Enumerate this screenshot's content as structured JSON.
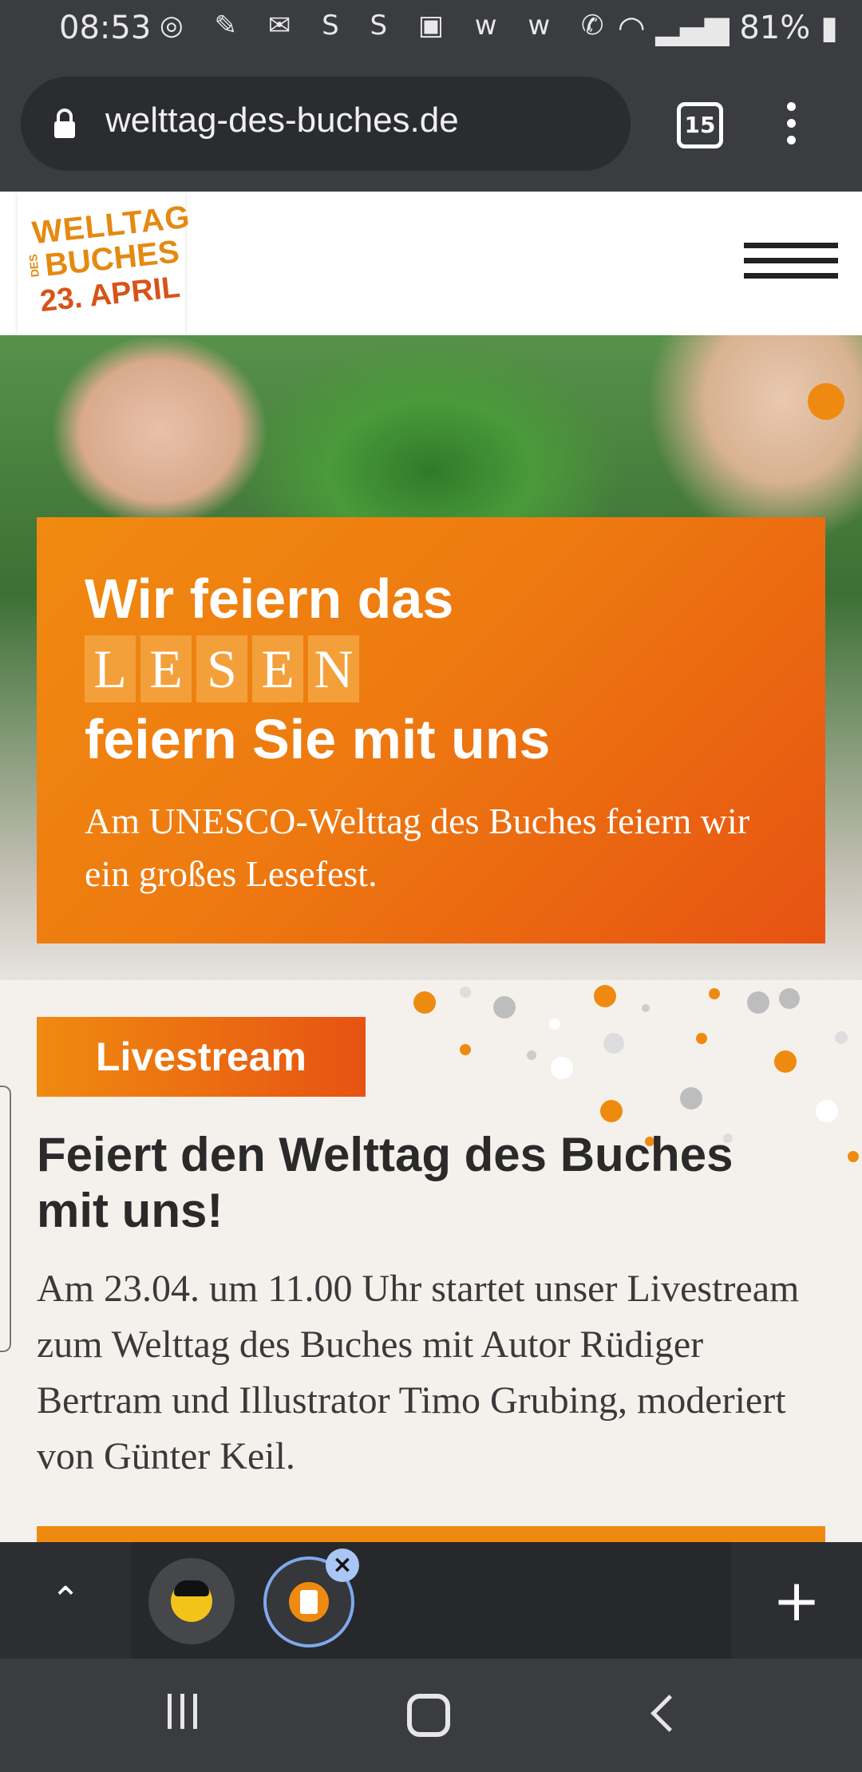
{
  "status": {
    "time": "08:53",
    "icons": "◎ ✎ ✉ S S ▣ w w ✆",
    "battery": "81%"
  },
  "browser": {
    "url": "welttag-des-buches.de",
    "tab_count": "15"
  },
  "site": {
    "logo": {
      "line1": "WELLTAG",
      "line2": "DES",
      "line3": "BUCHES",
      "line4": "23. APRIL"
    }
  },
  "hero": {
    "title_line1": "Wir feiern das",
    "highlight_letters": [
      "L",
      "E",
      "S",
      "E",
      "N"
    ],
    "title_line3": "feiern Sie mit uns",
    "subtitle": "Am UNESCO-Welttag des Buches feiern wir ein großes Lesefest."
  },
  "section": {
    "button": "Livestream",
    "title": "Feiert den Welttag des Buches mit uns!",
    "body": "Am 23.04. um 11.00 Uhr startet unser Livestream zum Welttag des Buches mit Autor Rüdiger Bertram und Illustrator Timo Grubing, moderiert von Günter Keil."
  },
  "tabbar": {
    "up": "⌃",
    "plus": "+",
    "close": "×"
  },
  "colors": {
    "orange": "#ef8a10",
    "orange_dark": "#e75312",
    "chrome": "#3a3c40"
  }
}
